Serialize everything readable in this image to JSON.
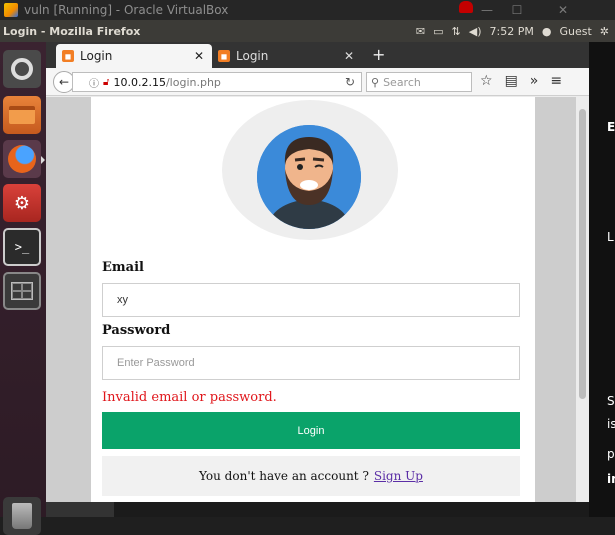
{
  "vbox": {
    "title": "vuln [Running] - Oracle VirtualBox",
    "minimize": "—",
    "maximize": "☐",
    "close": "✕"
  },
  "topbar": {
    "window_title": "Login - Mozilla Firefox",
    "time": "7:52 PM",
    "user": "Guest",
    "icons": [
      "mail-icon",
      "battery-icon",
      "network-icon",
      "volume-icon",
      "settings-icon"
    ]
  },
  "browser": {
    "tabs": [
      {
        "label": "Login",
        "active": true
      },
      {
        "label": "Login",
        "active": false
      }
    ],
    "url": {
      "host": "10.0.2.15",
      "path": "/login.php"
    },
    "search_placeholder": "Search"
  },
  "form": {
    "email_label": "Email",
    "email_value": "xy",
    "password_label": "Password",
    "password_placeholder": "Enter Password",
    "error": "Invalid email or password.",
    "login_button": "Login",
    "signup_text": "You don't have an account ?",
    "signup_link": "Sign Up"
  },
  "side_text": {
    "a": "E",
    "b": "L",
    "c": "S",
    "d": "is",
    "e": "p",
    "f": "in"
  },
  "colors": {
    "accent": "#0aa36a",
    "error": "#e0161b",
    "link": "#5b2ea6",
    "tab_favicon": "#f27e24"
  }
}
